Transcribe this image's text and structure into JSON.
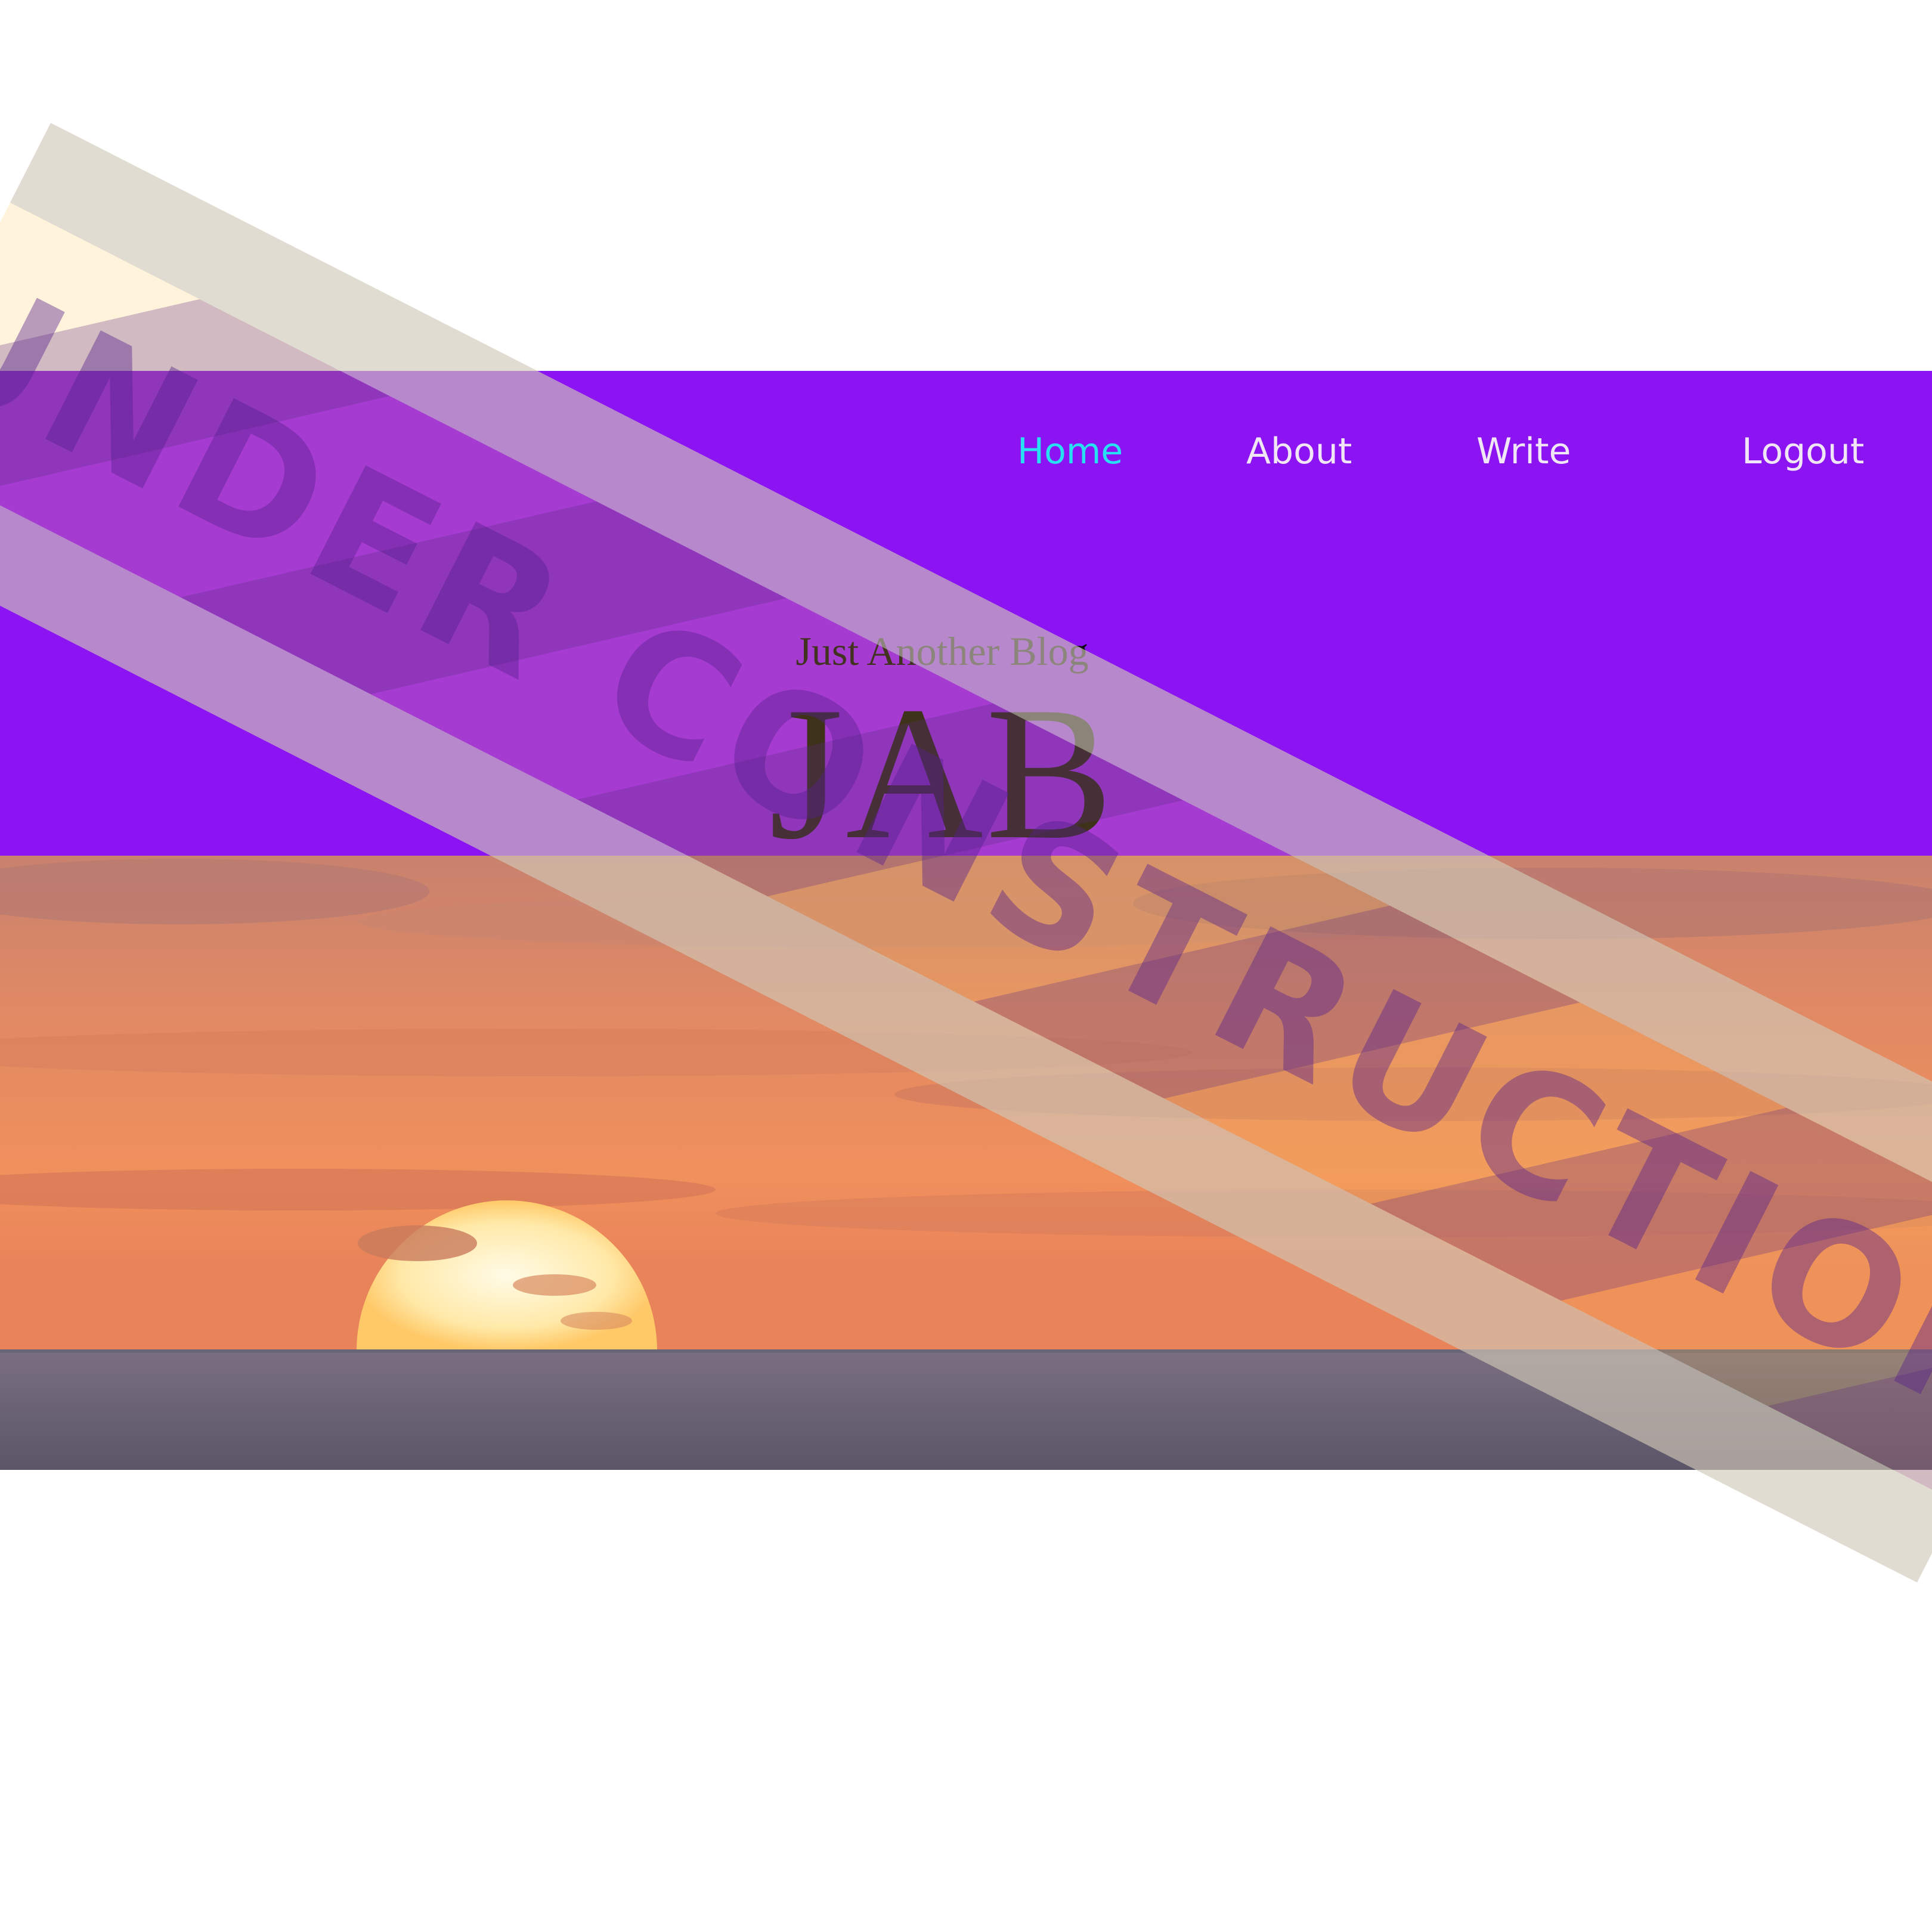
{
  "nav": {
    "items": [
      {
        "label": "Home",
        "active": true
      },
      {
        "label": "About",
        "active": false
      },
      {
        "label": "Write",
        "active": false
      },
      {
        "label": "Logout",
        "active": false
      }
    ]
  },
  "header": {
    "tagline": "Just Another Blog",
    "title": "JAB"
  },
  "overlay": {
    "text": "UNDER CONSTRUCTION"
  },
  "colors": {
    "header_bg": "#8c14f2",
    "nav_active": "#27e0f2",
    "nav_default": "#f1e6f7"
  },
  "hero": {
    "image": "sunset-over-ocean"
  }
}
